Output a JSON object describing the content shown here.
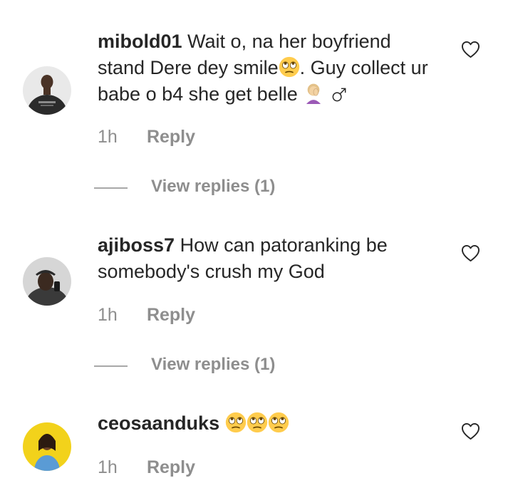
{
  "comments": [
    {
      "username": "mibold01",
      "text_1": "Wait o, na her boyfriend",
      "text_2": "stand Dere dey smile",
      "text_2b": ". Guy collect ur",
      "text_3": "babe o b4 she get belle",
      "time": "1h",
      "reply_label": "Reply",
      "view_replies": "View replies (1)",
      "emojis": [
        "face-with-rolling-eyes",
        "woman-facepalming",
        "male-sign"
      ]
    },
    {
      "username": "ajiboss7",
      "text_1": "How can patoranking be",
      "text_2": "somebody's crush my God",
      "time": "1h",
      "reply_label": "Reply",
      "view_replies": "View replies (1)"
    },
    {
      "username": "ceosaanduks",
      "time": "1h",
      "reply_label": "Reply",
      "emojis": [
        "face-with-rolling-eyes",
        "face-with-rolling-eyes",
        "face-with-rolling-eyes"
      ]
    }
  ],
  "colors": {
    "text": "#262626",
    "muted": "#8e8e8e",
    "emoji_yellow": "#ffcc4d"
  }
}
